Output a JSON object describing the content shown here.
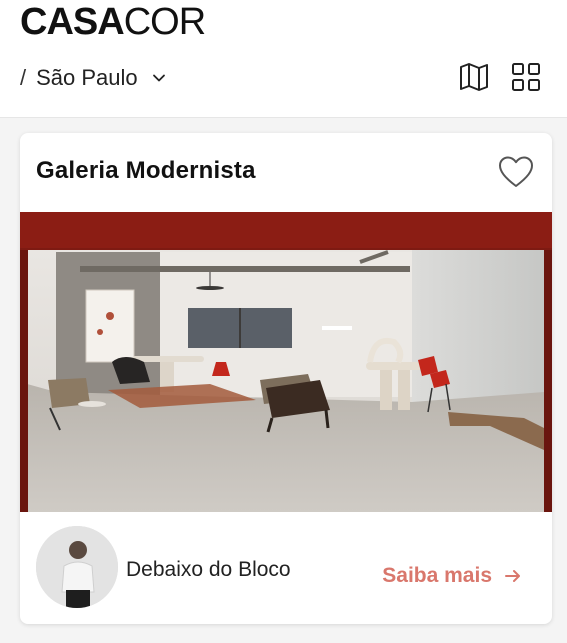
{
  "brand": {
    "logo_bold": "CASA",
    "logo_light": "COR"
  },
  "location": {
    "separator": "/",
    "city": "São Paulo"
  },
  "header_icons": {
    "map": "map-icon",
    "grid": "grid-icon"
  },
  "card": {
    "title": "Galeria Modernista",
    "favorite_icon": "heart-icon",
    "author": "Debaixo do Bloco",
    "cta_label": "Saiba mais",
    "cta_icon": "arrow-right-icon"
  },
  "colors": {
    "accent": "#d9776c",
    "frame_red": "#8b1d14",
    "background": "#f4f4f4"
  }
}
